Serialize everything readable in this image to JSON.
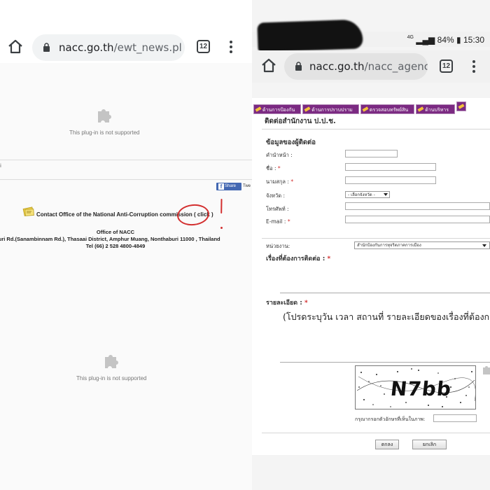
{
  "left": {
    "url_host": "nacc.go.th",
    "url_path": "/ewt_news.pl",
    "tab_count": "12",
    "plugin_message_top": "This plug-in is not supported",
    "plugin_message_bottom": "This plug-in is not supported",
    "share_label": "Share",
    "tweet_label": "Twe",
    "contact_line": "Contact Office of the National Anti-Corruption commission ( click )",
    "annotation_mark": "!",
    "office_title": "Office of NACC",
    "office_address": "Nonthaburi Rd.(Sanambinnam Rd.), Thasaai District, Amphur Muang, Nonthaburi 11000 , Thailand",
    "office_tel": "Tel (66) 2 528 4800-4849",
    "left_edge_char": "i"
  },
  "right": {
    "status": {
      "network": "4G",
      "battery": "84%",
      "time": "15:30"
    },
    "url_host": "nacc.go.th",
    "url_path": "/nacc_agency",
    "tab_count": "12",
    "nav_tabs": [
      "ด้านการป้องกัน",
      "ด้านการปราบปราม",
      "ตรวจสอบทรัพย์สิน",
      "ด้านบริหาร"
    ],
    "heading": "ติดต่อสำนักงาน ป.ป.ช.",
    "section_title": "ข้อมูลของผู้ติดต่อ",
    "fields": {
      "prefix": "คำนำหน้า :",
      "first_name": "ชื่อ :",
      "last_name": "นามสกุล :",
      "province": "จังหวัด :",
      "phone": "โทรศัพท์ :",
      "email": "E-mail :"
    },
    "province_select": "- เลือกจังหวัด -",
    "unit_label": "หน่วยงาน:",
    "unit_select": "สำนักป้องกันการทุจริตภาคการเมือง",
    "subject_label": "เรื่องที่ต้องการติดต่อ :",
    "detail_label": "รายละเอียด :",
    "detail_placeholder": "(โปรดระบุวัน เวลา สถานที่ รายละเอียดของเรื่องที่ต้องการติดต่อ)",
    "captcha_code": "N7bb",
    "captcha_hint": "กรุณากรอกตัวอักษรที่เห็นในภาพ:",
    "required_mark": "*",
    "buttons": {
      "submit": "ตกลง",
      "cancel": "ยกเลิก"
    }
  }
}
